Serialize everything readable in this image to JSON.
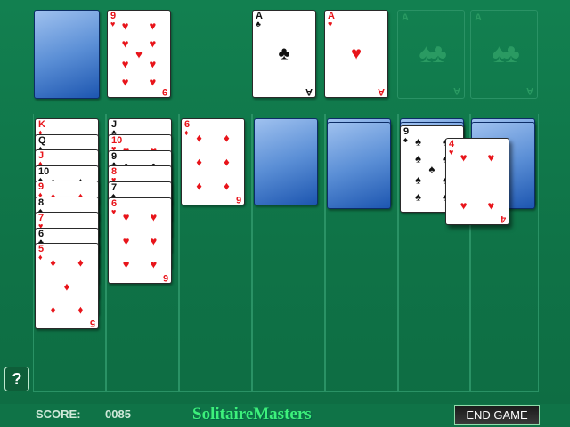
{
  "game": "Solitaire",
  "colors": {
    "felt": "#0f7347",
    "red_suit": "#e8141a",
    "black_suit": "#111111",
    "brand": "#3df07b"
  },
  "stock": {
    "face_down": true
  },
  "waste": {
    "rank": "9",
    "suit": "hearts"
  },
  "foundations": [
    {
      "rank": "A",
      "suit": "clubs"
    },
    {
      "rank": "A",
      "suit": "hearts"
    },
    {
      "rank": "A",
      "placeholder_suits": "spades/clubs",
      "empty": true
    },
    {
      "rank": "A",
      "placeholder_suits": "spades/clubs",
      "empty": true
    }
  ],
  "tableau": [
    {
      "cards": [
        {
          "rank": "K",
          "suit": "diamonds"
        },
        {
          "rank": "Q",
          "suit": "spades"
        },
        {
          "rank": "J",
          "suit": "diamonds"
        },
        {
          "rank": "10",
          "suit": "spades"
        },
        {
          "rank": "9",
          "suit": "diamonds"
        },
        {
          "rank": "8",
          "suit": "spades"
        },
        {
          "rank": "7",
          "suit": "hearts"
        },
        {
          "rank": "6",
          "suit": "clubs"
        },
        {
          "rank": "5",
          "suit": "diamonds"
        }
      ]
    },
    {
      "cards": [
        {
          "rank": "J",
          "suit": "clubs"
        },
        {
          "rank": "10",
          "suit": "hearts"
        },
        {
          "rank": "9",
          "suit": "clubs"
        },
        {
          "rank": "8",
          "suit": "hearts"
        },
        {
          "rank": "7",
          "suit": "spades"
        },
        {
          "rank": "6",
          "suit": "hearts"
        }
      ]
    },
    {
      "cards": [
        {
          "rank": "6",
          "suit": "diamonds"
        }
      ]
    },
    {
      "cards": [
        {
          "back": true
        }
      ]
    },
    {
      "cards": [
        {
          "back": true
        },
        {
          "back": true
        }
      ]
    },
    {
      "cards": [
        {
          "back": true
        },
        {
          "back": true
        },
        {
          "rank": "9",
          "suit": "spades"
        }
      ]
    },
    {
      "cards": [
        {
          "back": true
        },
        {
          "back": true
        }
      ]
    }
  ],
  "dragged_card": {
    "rank": "4",
    "suit": "hearts"
  },
  "score": {
    "label": "SCORE:",
    "value": "0085"
  },
  "brand": "SolitaireMasters",
  "end_game_label": "END GAME",
  "help_label": "?"
}
